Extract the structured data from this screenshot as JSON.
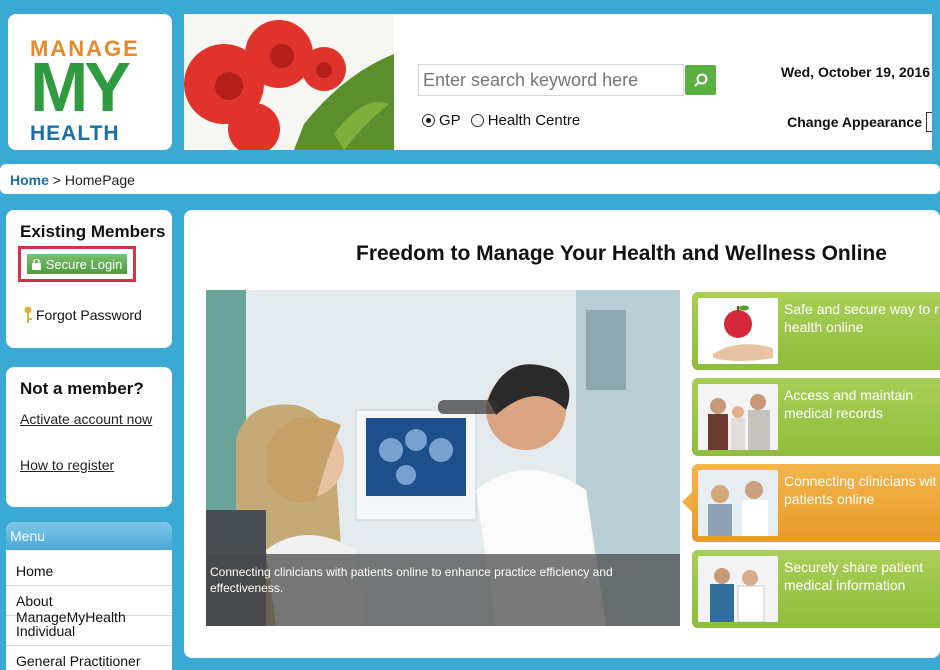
{
  "logo": {
    "line1": "MANAGE",
    "line2": "MY",
    "line3": "HEALTH"
  },
  "search": {
    "placeholder": "Enter search keyword here",
    "options": [
      "GP",
      "Health Centre"
    ],
    "selected": "GP"
  },
  "date": "Wed, October 19, 2016",
  "appearance_label": "Change Appearance",
  "breadcrumb": {
    "home": "Home",
    "separator": " > ",
    "current": "HomePage"
  },
  "members": {
    "title": "Existing Members",
    "login_label": "Secure Login",
    "forgot_label": "Forgot Password"
  },
  "notmember": {
    "title": "Not a member?",
    "activate": "Activate account now",
    "register": "How to register"
  },
  "menu": {
    "title": "Menu",
    "items": [
      "Home",
      "About ManageMyHealth",
      "Individual",
      "General Practitioner"
    ]
  },
  "main": {
    "title": "Freedom to Manage Your Health and Wellness Online",
    "hero_caption": "Connecting clinicians with patients online to enhance practice efficiency and effectiveness.",
    "cards": [
      {
        "line1": "Safe and secure way to r",
        "line2": "health online",
        "color": "green"
      },
      {
        "line1": "Access and maintain",
        "line2": "medical records",
        "color": "green"
      },
      {
        "line1": "Connecting clinicians wit",
        "line2": "patients online",
        "color": "orange"
      },
      {
        "line1": "Securely share patient",
        "line2": "medical information",
        "color": "green"
      }
    ]
  },
  "colors": {
    "frame": "#3aa9d3",
    "brand_green": "#2f9a3e",
    "brand_orange": "#e58a2b",
    "brand_blue": "#1b6fa8",
    "login_outline": "#d43348"
  }
}
